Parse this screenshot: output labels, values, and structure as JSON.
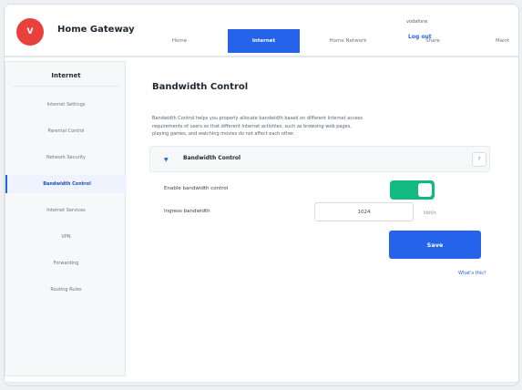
{
  "header": {
    "logo_letter": "V",
    "app_title": "Home Gateway",
    "provider": "vodafone",
    "logout_label": "Log out",
    "tabs": [
      {
        "label": "Home"
      },
      {
        "label": "Internet"
      },
      {
        "label": "Home Network"
      },
      {
        "label": "Share"
      },
      {
        "label": "Maint"
      }
    ],
    "active_tab": "Internet"
  },
  "sidebar": {
    "title": "Internet",
    "items": [
      {
        "label": "Internet Settings"
      },
      {
        "label": "Parental Control"
      },
      {
        "label": "Network Security"
      },
      {
        "label": "Bandwidth Control"
      },
      {
        "label": "Internet Services"
      },
      {
        "label": "VPN"
      },
      {
        "label": "Forwarding"
      },
      {
        "label": "Routing Rules"
      }
    ],
    "active_item": "Bandwidth Control"
  },
  "main": {
    "title": "Bandwidth Control",
    "description": "Bandwidth Control helps you properly allocate bandwidth based on different Internet access requirements of users so that different Internet activities, such as browsing web pages, playing games, and watching movies do not affect each other.",
    "section": {
      "title": "Bandwidth Control",
      "collapse_icon": "▼",
      "help_label": "?"
    },
    "enable_label": "Enable bandwidth control",
    "enable_state": "on",
    "ingress_label": "Ingress bandwidth",
    "ingress_value": "1024",
    "ingress_unit": "kbit/s",
    "save_label": "Save",
    "whats_this_label": "What's this?"
  },
  "colors": {
    "accent": "#2563eb",
    "toggle_on": "#12b981",
    "logo": "#e8403c"
  }
}
